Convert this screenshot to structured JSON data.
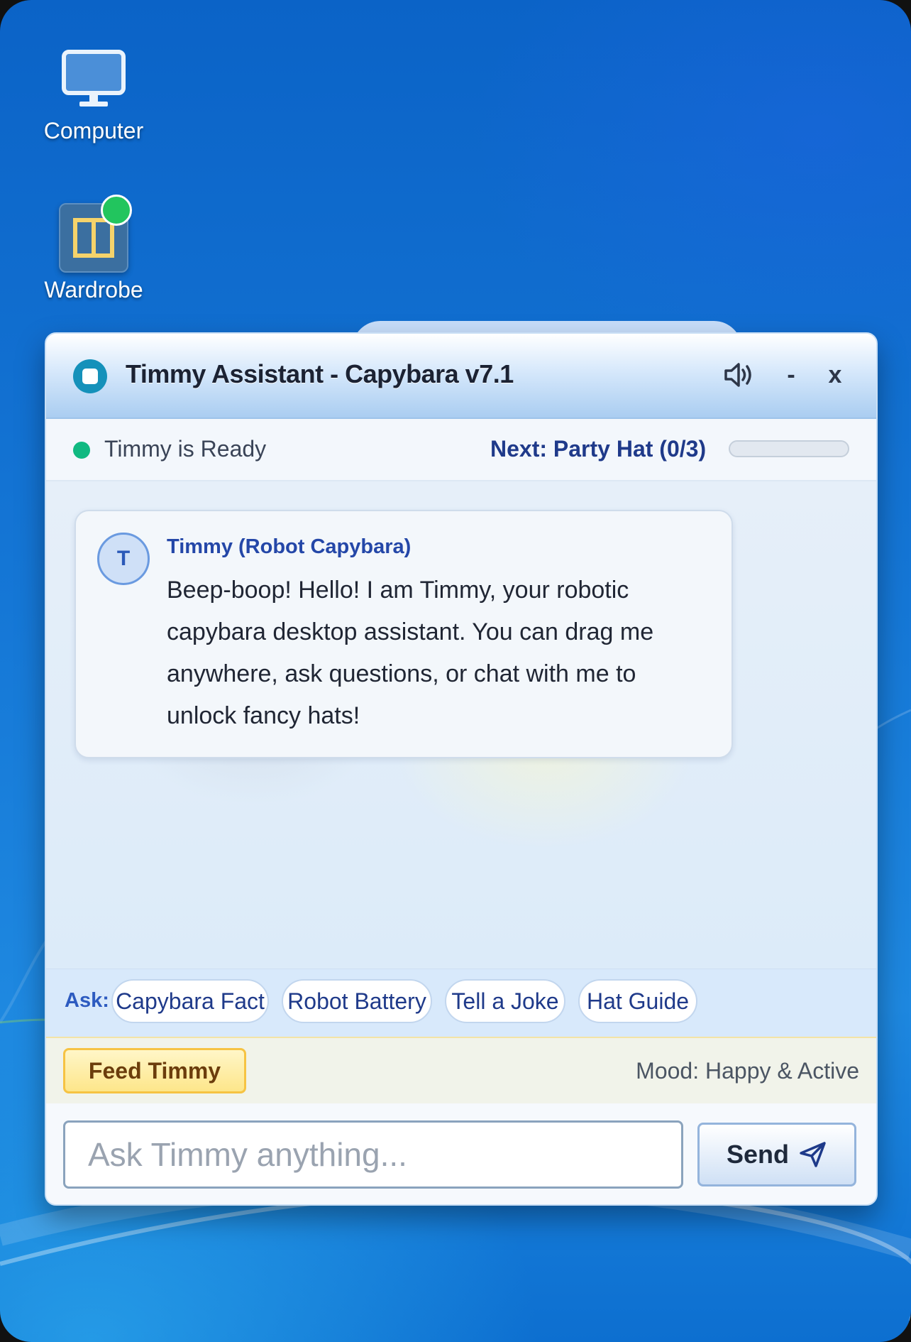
{
  "desktop": {
    "icons": [
      {
        "label": "Computer"
      },
      {
        "label": "Wardrobe"
      }
    ]
  },
  "window": {
    "title": "Timmy Assistant - Capybara v7.1",
    "minimize_label": "-",
    "close_label": "x",
    "status": {
      "ready_text": "Timmy is Ready",
      "next_unlock": "Next: Party Hat (0/3)",
      "progress_fraction": 0
    },
    "chat": {
      "messages": [
        {
          "avatar_initial": "T",
          "sender": "Timmy (Robot Capybara)",
          "text": "Beep-boop! Hello! I am Timmy, your robotic capybara desktop assistant. You can drag me anywhere, ask questions, or chat with me to unlock fancy hats!"
        }
      ]
    },
    "quick_ask": {
      "label": "Ask:",
      "chips": [
        "Capybara Fact",
        "Robot Battery",
        "Tell a Joke",
        "Hat Guide"
      ]
    },
    "feed": {
      "button_label": "Feed Timmy",
      "mood_text": "Mood: Happy & Active"
    },
    "composer": {
      "placeholder": "Ask Timmy anything...",
      "value": "",
      "send_label": "Send"
    }
  },
  "colors": {
    "accent": "#1f3a8a",
    "ready": "#10b981",
    "notification": "#22c55e",
    "feed_button": "#fde68a"
  },
  "icons": [
    "computer-icon",
    "wardrobe-icon",
    "speaker-icon",
    "send-icon"
  ]
}
